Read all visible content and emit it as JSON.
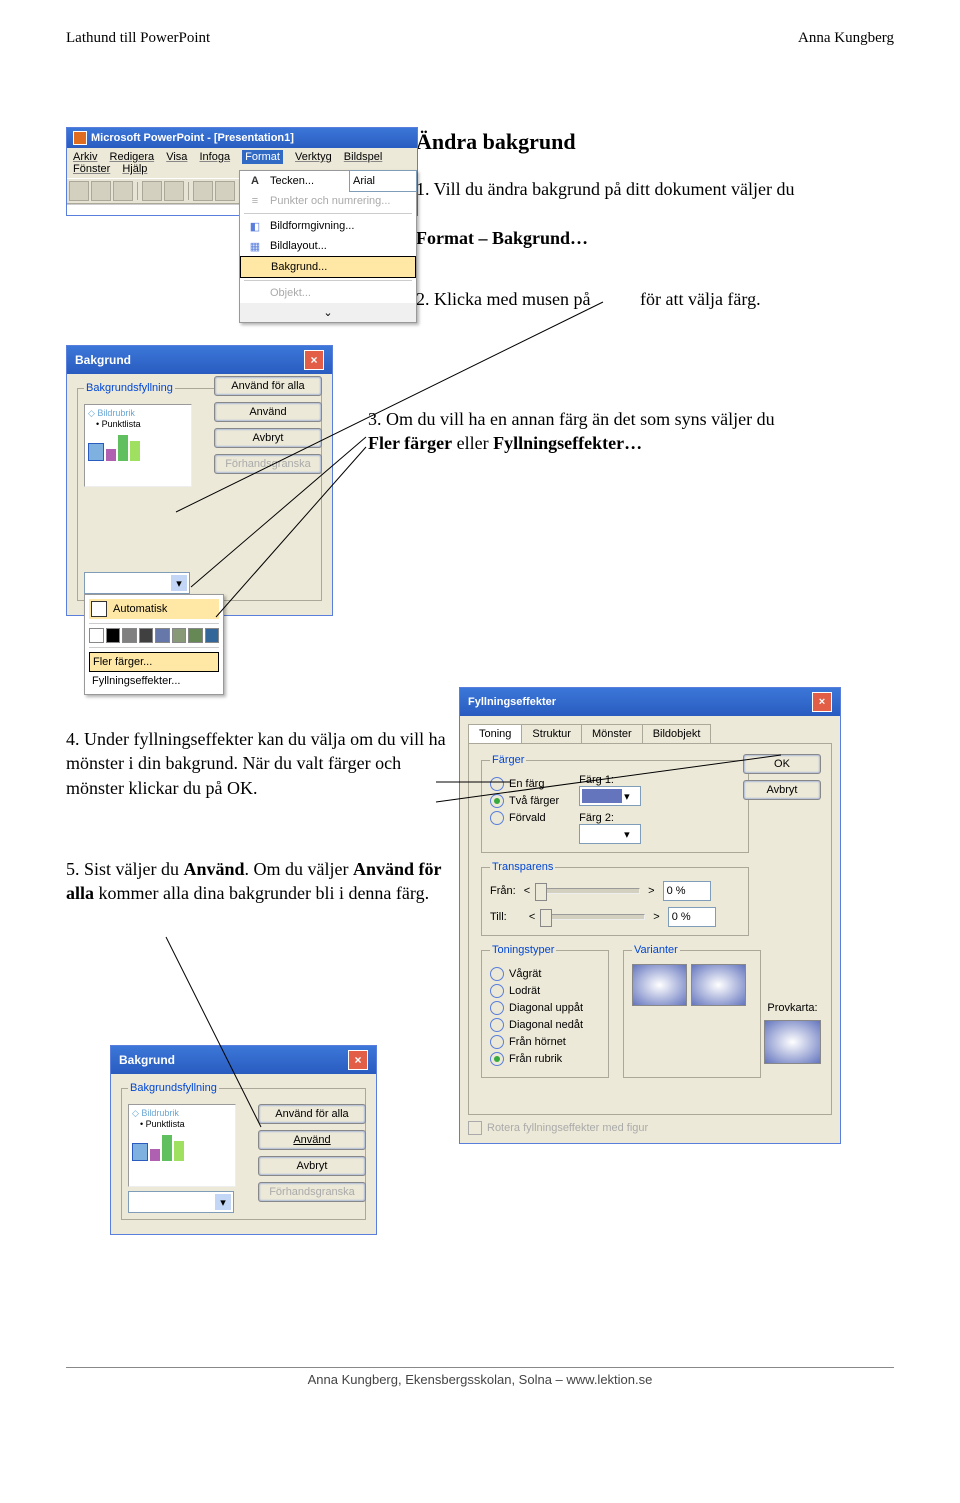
{
  "header": {
    "left": "Lathund till PowerPoint",
    "right": "Anna Kungberg"
  },
  "footer": "Anna Kungberg, Ekensbergsskolan, Solna – www.lektion.se",
  "text": {
    "title": "Ändra bakgrund",
    "step1a": "1. Vill du ändra bakgrund på ditt dokument väljer du",
    "step1b": "Format – Bakgrund…",
    "step2a": "2. Klicka med musen på",
    "step2b": "för att välja färg.",
    "step3a": "3. Om du vill ha en annan färg än det som syns väljer du",
    "step3b": "Fler färger",
    "step3c": " eller ",
    "step3d": "Fyllningseffekter…",
    "step4": "4. Under fyllningseffekter kan du välja om du vill ha mönster i din bakgrund. När du valt färger och mönster klickar du på OK.",
    "step5a": "5. Sist väljer du ",
    "step5b": "Använd",
    "step5c": ". Om du väljer ",
    "step5d": "Använd för alla",
    "step5e": " kommer alla dina bakgrunder bli i denna färg."
  },
  "ss1": {
    "title": "Microsoft PowerPoint - [Presentation1]",
    "menus": [
      "Arkiv",
      "Redigera",
      "Visa",
      "Infoga",
      "Format",
      "Verktyg",
      "Bildspel",
      "Fönster",
      "Hjälp"
    ],
    "menu_selected": "Format",
    "dropdown": [
      {
        "label": "Tecken...",
        "icon": "A"
      },
      {
        "label": "Punkter och numrering...",
        "gray": true,
        "icon": "≡"
      },
      {
        "label": "Bildformgivning...",
        "icon": "◧"
      },
      {
        "label": "Bildlayout...",
        "icon": "▦"
      },
      {
        "label": "Bakgrund...",
        "sel": true,
        "icon": ""
      },
      {
        "label": "Objekt...",
        "gray": true,
        "icon": ""
      }
    ],
    "fontbox": "Arial"
  },
  "bakgrund": {
    "title": "Bakgrund",
    "group_label": "Bakgrundsfyllning",
    "preview_title": "Bildrubrik",
    "preview_bullet": "Punktlista",
    "buttons": {
      "apply_all": "Använd för alla",
      "apply": "Använd",
      "cancel": "Avbryt",
      "preview": "Förhandsgranska"
    },
    "colormenu": {
      "auto": "Automatisk",
      "more": "Fler färger...",
      "effects": "Fyllningseffekter...",
      "swatches": [
        "#ffffff",
        "#000000",
        "#808080",
        "#404040",
        "#6677aa",
        "#889977",
        "#668855",
        "#336699"
      ]
    }
  },
  "fyll": {
    "title": "Fyllningseffekter",
    "tabs": [
      "Toning",
      "Struktur",
      "Mönster",
      "Bildobjekt"
    ],
    "groups": {
      "colors": "Färger",
      "transparency": "Transparens",
      "shading": "Toningstyper",
      "variants": "Varianter"
    },
    "color_options": [
      "En färg",
      "Två färger",
      "Förvald"
    ],
    "color_labels": {
      "c1": "Färg 1:",
      "c2": "Färg 2:"
    },
    "transparency": {
      "from": "Från:",
      "to": "Till:",
      "pct": "0 %"
    },
    "shading_options": [
      "Vågrät",
      "Lodrät",
      "Diagonal uppåt",
      "Diagonal nedåt",
      "Från hörnet",
      "Från rubrik"
    ],
    "sample_label": "Provkarta:",
    "rotate": "Rotera fyllningseffekter med figur",
    "buttons": {
      "ok": "OK",
      "cancel": "Avbryt"
    }
  }
}
